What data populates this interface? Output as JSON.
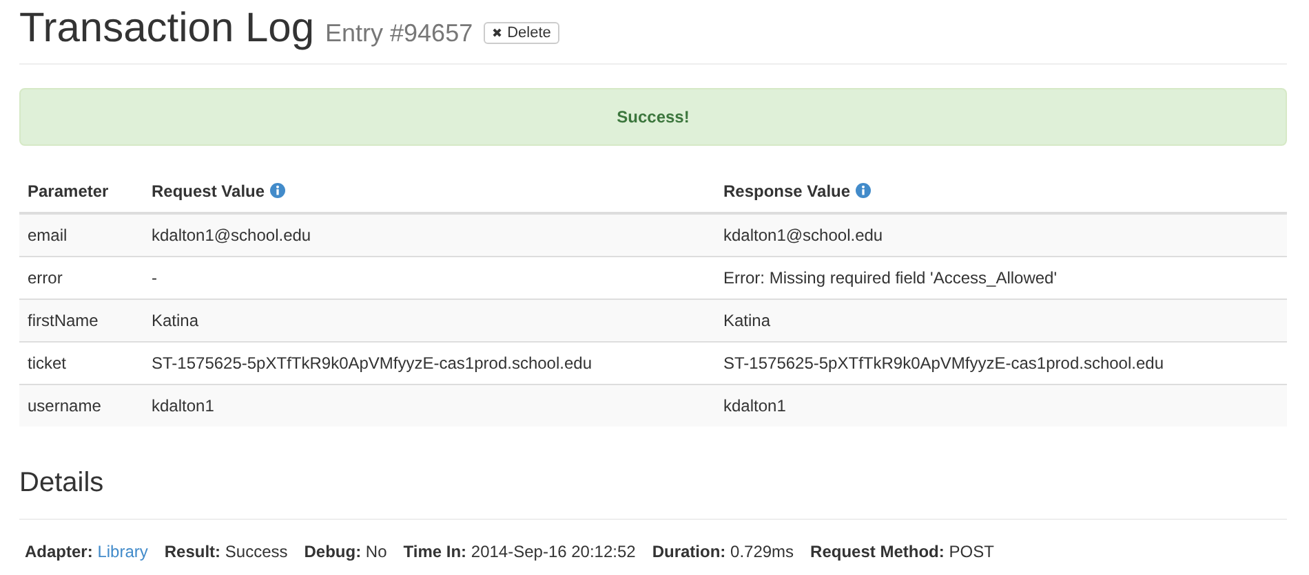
{
  "header": {
    "title": "Transaction Log",
    "subtitle": "Entry #94657",
    "delete_button": {
      "icon": "✖",
      "label": "Delete"
    }
  },
  "alert": {
    "message": "Success!"
  },
  "table": {
    "columns": [
      {
        "label": "Parameter",
        "info": false
      },
      {
        "label": "Request Value",
        "info": true
      },
      {
        "label": "Response Value",
        "info": true
      }
    ],
    "rows": [
      [
        "email",
        "kdalton1@school.edu",
        "kdalton1@school.edu"
      ],
      [
        "error",
        "-",
        "Error: Missing required field 'Access_Allowed'"
      ],
      [
        "firstName",
        "Katina",
        "Katina"
      ],
      [
        "ticket",
        "ST-1575625-5pXTfTkR9k0ApVMfyyzE-cas1prod.school.edu",
        "ST-1575625-5pXTfTkR9k0ApVMfyyzE-cas1prod.school.edu"
      ],
      [
        "username",
        "kdalton1",
        "kdalton1"
      ]
    ]
  },
  "details": {
    "heading": "Details",
    "items": [
      {
        "label": "Adapter:",
        "value": "Library",
        "kind": "link"
      },
      {
        "label": "Result:",
        "value": "Success",
        "kind": "text"
      },
      {
        "label": "Debug:",
        "value": "No",
        "kind": "text"
      },
      {
        "label": "Time In:",
        "value": "2014-Sep-16 20:12:52",
        "kind": "text"
      },
      {
        "label": "Duration:",
        "value": "0.729ms",
        "kind": "text"
      },
      {
        "label": "Request Method:",
        "value": "POST",
        "kind": "text"
      }
    ]
  }
}
